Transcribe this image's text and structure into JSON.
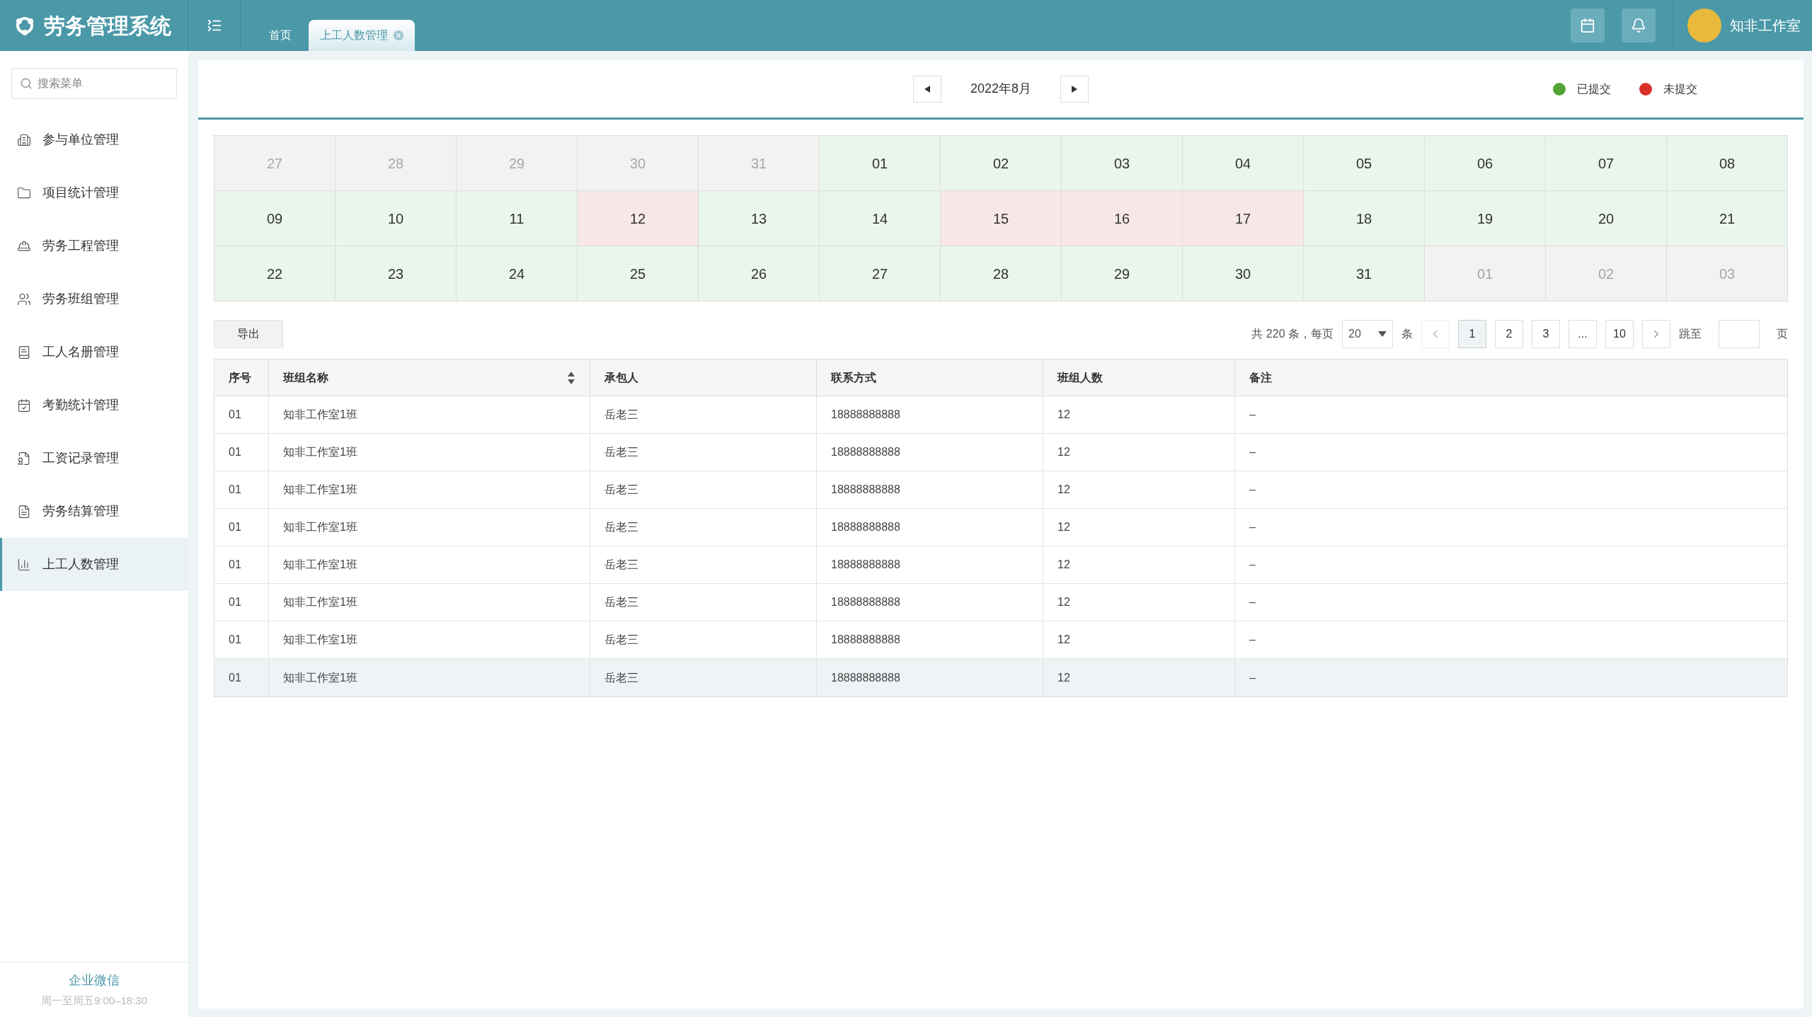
{
  "app": {
    "title": "劳务管理系统",
    "user": "知非工作室"
  },
  "tabs": [
    {
      "label": "首页",
      "selected": false
    },
    {
      "label": "上工人数管理",
      "selected": true
    }
  ],
  "sidebar": {
    "search": {
      "placeholder": "搜索菜单"
    },
    "items": [
      {
        "label": "参与单位管理",
        "selected": false
      },
      {
        "label": "项目统计管理",
        "selected": false
      },
      {
        "label": "劳务工程管理",
        "selected": false
      },
      {
        "label": "劳务班组管理",
        "selected": false
      },
      {
        "label": "工人名册管理",
        "selected": false
      },
      {
        "label": "考勤统计管理",
        "selected": false
      },
      {
        "label": "工资记录管理",
        "selected": false
      },
      {
        "label": "劳务结算管理",
        "selected": false
      },
      {
        "label": "上工人数管理",
        "selected": true
      }
    ],
    "footer": {
      "title": "企业微信",
      "hours": "周一至周五9:00–18:30"
    }
  },
  "calendar": {
    "month": "2022年8月",
    "legend": [
      {
        "label": "已提交",
        "color": "#52a436"
      },
      {
        "label": "未提交",
        "color": "#d9302a"
      }
    ],
    "days": [
      {
        "label": "27",
        "kind": "outside"
      },
      {
        "label": "28",
        "kind": "outside"
      },
      {
        "label": "29",
        "kind": "outside"
      },
      {
        "label": "30",
        "kind": "outside"
      },
      {
        "label": "31",
        "kind": "outside"
      },
      {
        "label": "01",
        "kind": "submitted"
      },
      {
        "label": "02",
        "kind": "submitted"
      },
      {
        "label": "03",
        "kind": "submitted"
      },
      {
        "label": "04",
        "kind": "submitted"
      },
      {
        "label": "05",
        "kind": "submitted"
      },
      {
        "label": "06",
        "kind": "submitted"
      },
      {
        "label": "07",
        "kind": "submitted"
      },
      {
        "label": "08",
        "kind": "submitted"
      },
      {
        "label": "09",
        "kind": "submitted"
      },
      {
        "label": "10",
        "kind": "submitted"
      },
      {
        "label": "11",
        "kind": "submitted"
      },
      {
        "label": "12",
        "kind": "missing"
      },
      {
        "label": "13",
        "kind": "submitted"
      },
      {
        "label": "14",
        "kind": "submitted"
      },
      {
        "label": "15",
        "kind": "missing"
      },
      {
        "label": "16",
        "kind": "missing"
      },
      {
        "label": "17",
        "kind": "missing"
      },
      {
        "label": "18",
        "kind": "submitted"
      },
      {
        "label": "19",
        "kind": "submitted"
      },
      {
        "label": "20",
        "kind": "submitted"
      },
      {
        "label": "21",
        "kind": "submitted"
      },
      {
        "label": "22",
        "kind": "submitted"
      },
      {
        "label": "23",
        "kind": "submitted"
      },
      {
        "label": "24",
        "kind": "submitted"
      },
      {
        "label": "25",
        "kind": "submitted"
      },
      {
        "label": "26",
        "kind": "submitted"
      },
      {
        "label": "27",
        "kind": "submitted"
      },
      {
        "label": "28",
        "kind": "submitted"
      },
      {
        "label": "29",
        "kind": "submitted"
      },
      {
        "label": "30",
        "kind": "submitted"
      },
      {
        "label": "31",
        "kind": "submitted"
      },
      {
        "label": "01",
        "kind": "outside"
      },
      {
        "label": "02",
        "kind": "outside"
      },
      {
        "label": "03",
        "kind": "outside"
      }
    ]
  },
  "export_button": "导出",
  "pagination": {
    "total": "共 220 条，每页",
    "page_size": "20",
    "unit": "条",
    "pages": [
      {
        "label": "1",
        "selected": true
      },
      {
        "label": "2",
        "selected": false
      },
      {
        "label": "3",
        "selected": false
      },
      {
        "label": "...",
        "selected": false
      },
      {
        "label": "10",
        "selected": false
      }
    ],
    "jump_label": "跳至",
    "jump_suffix": "页"
  },
  "table": {
    "columns": [
      {
        "label": "序号"
      },
      {
        "label": "班组名称"
      },
      {
        "label": "承包人"
      },
      {
        "label": "联系方式"
      },
      {
        "label": "班组人数"
      },
      {
        "label": "备注"
      }
    ],
    "rows": [
      {
        "cells": [
          "01",
          "知非工作室1班",
          "岳老三",
          "18888888888",
          "12",
          "–"
        ],
        "selected": false
      },
      {
        "cells": [
          "01",
          "知非工作室1班",
          "岳老三",
          "18888888888",
          "12",
          "–"
        ],
        "selected": false
      },
      {
        "cells": [
          "01",
          "知非工作室1班",
          "岳老三",
          "18888888888",
          "12",
          "–"
        ],
        "selected": false
      },
      {
        "cells": [
          "01",
          "知非工作室1班",
          "岳老三",
          "18888888888",
          "12",
          "–"
        ],
        "selected": false
      },
      {
        "cells": [
          "01",
          "知非工作室1班",
          "岳老三",
          "18888888888",
          "12",
          "–"
        ],
        "selected": false
      },
      {
        "cells": [
          "01",
          "知非工作室1班",
          "岳老三",
          "18888888888",
          "12",
          "–"
        ],
        "selected": false
      },
      {
        "cells": [
          "01",
          "知非工作室1班",
          "岳老三",
          "18888888888",
          "12",
          "–"
        ],
        "selected": false
      },
      {
        "cells": [
          "01",
          "知非工作室1班",
          "岳老三",
          "18888888888",
          "12",
          "–"
        ],
        "selected": true
      }
    ]
  }
}
